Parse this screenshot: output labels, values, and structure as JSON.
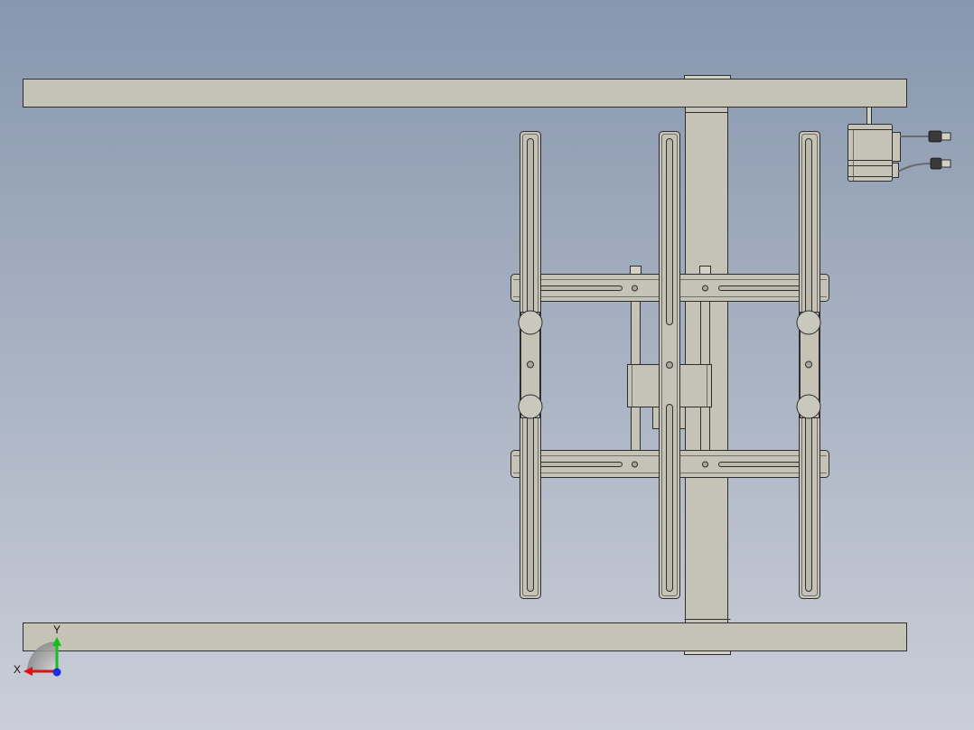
{
  "triad": {
    "x_label": "X",
    "y_label": "Y"
  },
  "colors": {
    "background_top": "#8797ae",
    "background_bottom": "#cbced8",
    "part_fill": "#c4c3b6",
    "edge": "#2e2e2e",
    "x_axis": "#e01010",
    "y_axis": "#12c01e",
    "z_axis": "#1a2fe0"
  },
  "icons": {
    "triad": "coordinate-triad-icon",
    "motor": "servo-motor-icon"
  }
}
